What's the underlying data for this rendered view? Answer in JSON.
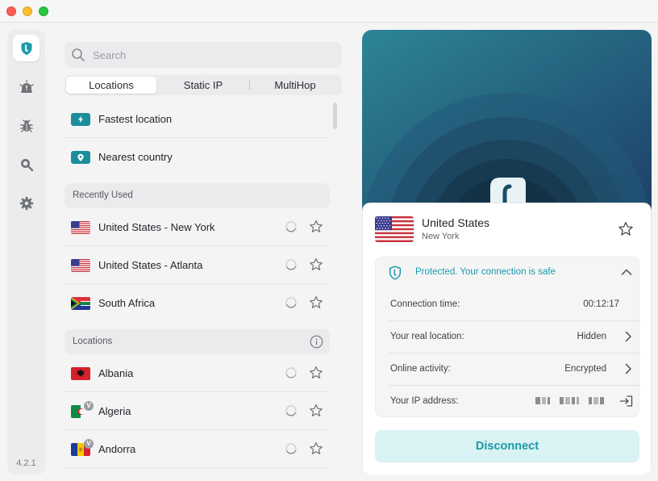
{
  "window": {
    "controls": [
      "close",
      "minimize",
      "maximize"
    ]
  },
  "rail": {
    "items": [
      {
        "name": "shield-icon",
        "active": true
      },
      {
        "name": "alert-icon",
        "active": false
      },
      {
        "name": "bug-icon",
        "active": false
      },
      {
        "name": "zoom-search-icon",
        "active": false
      },
      {
        "name": "gear-icon",
        "active": false
      }
    ],
    "version": "4.2.1"
  },
  "search": {
    "placeholder": "Search",
    "value": ""
  },
  "tabs": [
    {
      "label": "Locations",
      "active": true
    },
    {
      "label": "Static IP",
      "active": false
    },
    {
      "label": "MultiHop",
      "active": false
    }
  ],
  "quick": {
    "fastest": {
      "label": "Fastest location",
      "icon": "bolt-icon"
    },
    "nearest": {
      "label": "Nearest country",
      "icon": "pin-icon"
    }
  },
  "recent": {
    "header": "Recently Used",
    "items": [
      {
        "label": "United States - New York",
        "flag": "us"
      },
      {
        "label": "United States - Atlanta",
        "flag": "us"
      },
      {
        "label": "South Africa",
        "flag": "za"
      }
    ]
  },
  "locations": {
    "header": "Locations",
    "items": [
      {
        "label": "Albania",
        "flag": "al",
        "virtual": false
      },
      {
        "label": "Algeria",
        "flag": "dz",
        "virtual": true
      },
      {
        "label": "Andorra",
        "flag": "ad",
        "virtual": true
      }
    ],
    "virtual_badge": "V"
  },
  "connection": {
    "country": "United States",
    "city": "New York",
    "status": "Protected. Your connection is safe",
    "rows": {
      "time": {
        "key": "Connection time:",
        "value": "00:12:17"
      },
      "real_location": {
        "key": "Your real location:",
        "value": "Hidden"
      },
      "activity": {
        "key": "Online activity:",
        "value": "Encrypted"
      },
      "ip": {
        "key": "Your IP address:",
        "value_redacted": true
      }
    },
    "disconnect_label": "Disconnect"
  },
  "colors": {
    "accent": "#1b9aaa",
    "hero_light": "#2a7f93",
    "hero_dark": "#1f4a6e",
    "disconnect_bg": "#d9f2f3"
  }
}
